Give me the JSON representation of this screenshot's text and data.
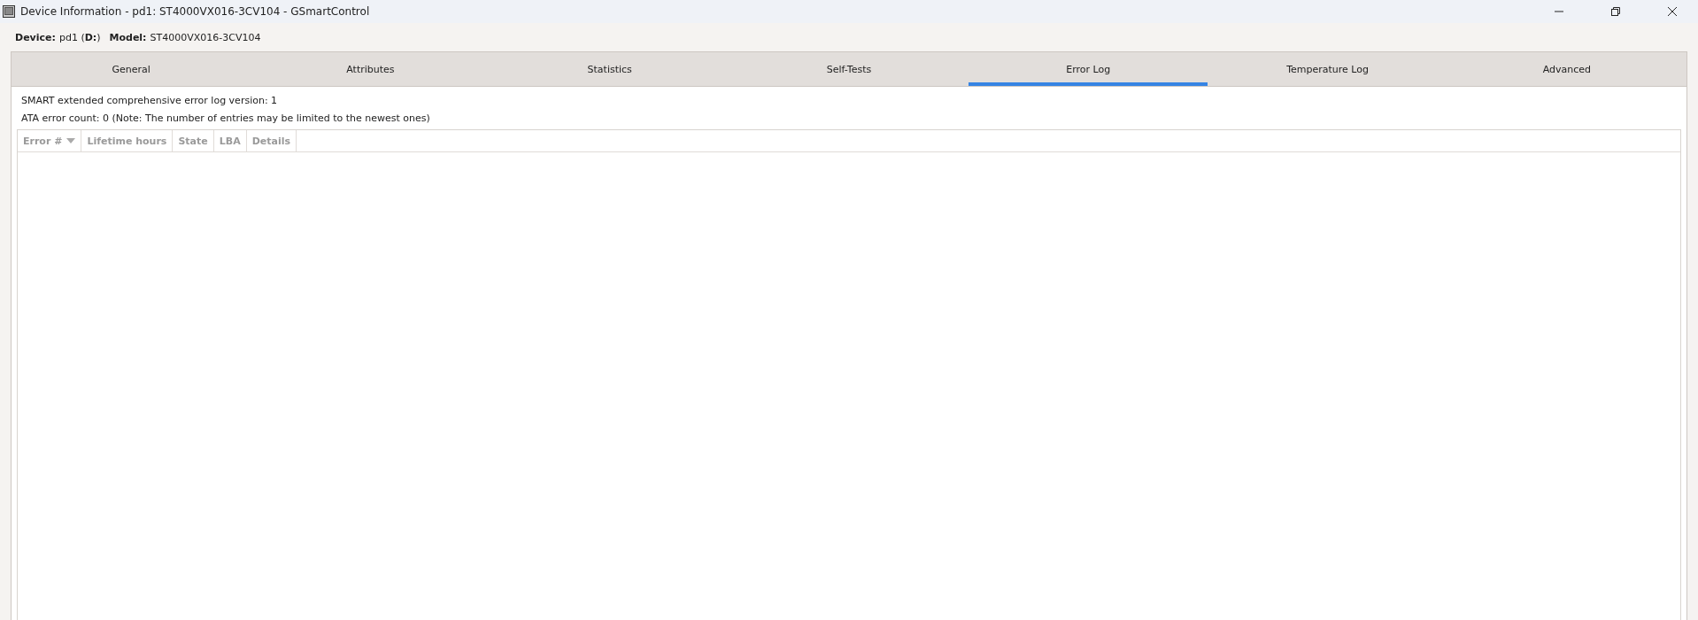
{
  "window": {
    "title": "Device Information - pd1: ST4000VX016-3CV104 - GSmartControl"
  },
  "device_info": [
    {
      "label": "Device:",
      "value": "pd1 (**D:**)"
    },
    {
      "label": "Model:",
      "value": "ST4000VX016-3CV104"
    }
  ],
  "tabs": [
    {
      "label": "General",
      "selected": false
    },
    {
      "label": "Attributes",
      "selected": false
    },
    {
      "label": "Statistics",
      "selected": false
    },
    {
      "label": "Self-Tests",
      "selected": false
    },
    {
      "label": "Error Log",
      "selected": true
    },
    {
      "label": "Temperature Log",
      "selected": false
    },
    {
      "label": "Advanced",
      "selected": false
    }
  ],
  "info_lines": [
    "SMART extended comprehensive error log version: 1",
    "ATA error count: 0 (Note: The number of entries may be limited to the newest ones)"
  ],
  "table": {
    "columns": [
      {
        "label": "Error #",
        "sorted": true
      },
      {
        "label": "Lifetime hours",
        "sorted": false
      },
      {
        "label": "State",
        "sorted": false
      },
      {
        "label": "LBA",
        "sorted": false
      },
      {
        "label": "Details",
        "sorted": false
      }
    ]
  }
}
